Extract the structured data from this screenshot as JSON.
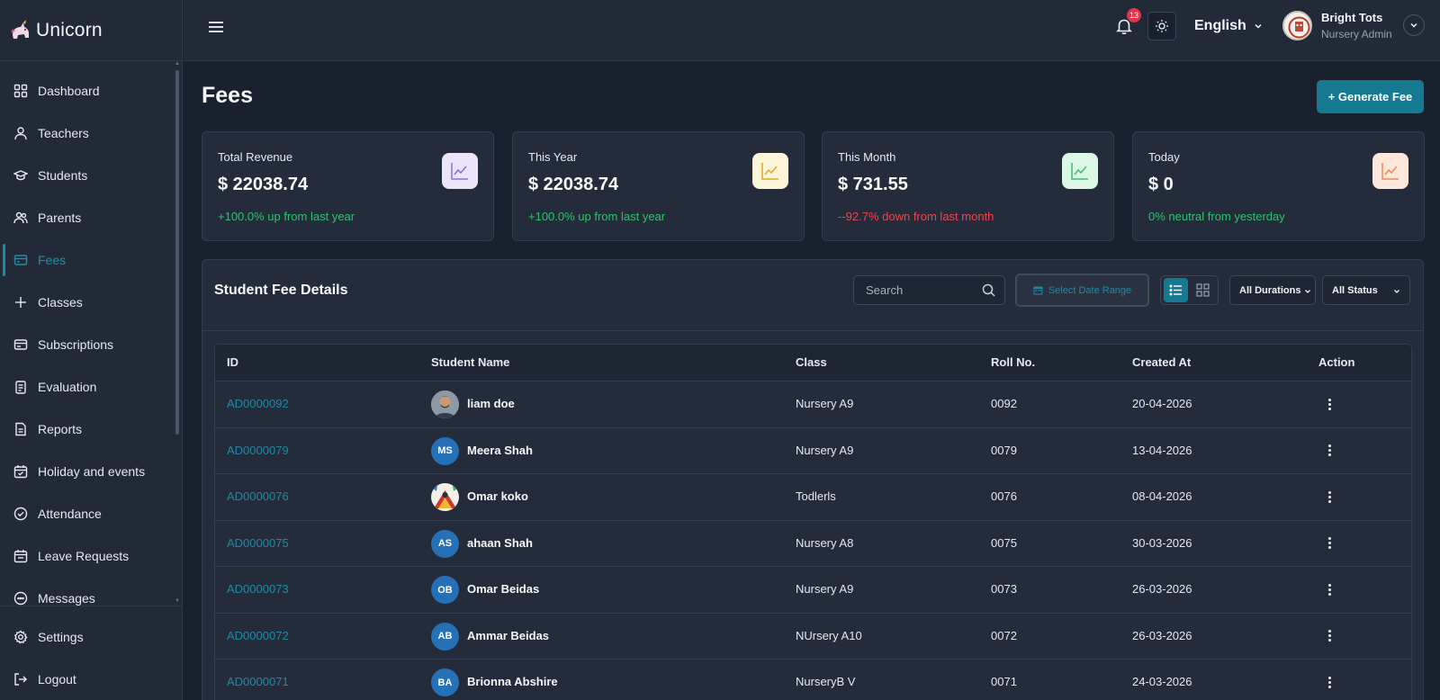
{
  "app": {
    "name": "Unicorn"
  },
  "sidebar": {
    "items": [
      {
        "label": "Dashboard",
        "icon": "dashboard-icon"
      },
      {
        "label": "Teachers",
        "icon": "user-icon"
      },
      {
        "label": "Students",
        "icon": "graduation-cap-icon"
      },
      {
        "label": "Parents",
        "icon": "users-icon"
      },
      {
        "label": "Fees",
        "icon": "credit-card-icon",
        "active": true
      },
      {
        "label": "Classes",
        "icon": "plus-icon"
      },
      {
        "label": "Subscriptions",
        "icon": "card-icon"
      },
      {
        "label": "Evaluation",
        "icon": "clipboard-icon"
      },
      {
        "label": "Reports",
        "icon": "document-icon"
      },
      {
        "label": "Holiday and events",
        "icon": "calendar-icon"
      },
      {
        "label": "Attendance",
        "icon": "check-circle-icon"
      },
      {
        "label": "Leave Requests",
        "icon": "calendar-check-icon"
      },
      {
        "label": "Messages",
        "icon": "message-icon"
      }
    ],
    "bottom": [
      {
        "label": "Settings",
        "icon": "gear-icon"
      },
      {
        "label": "Logout",
        "icon": "logout-icon"
      }
    ]
  },
  "topbar": {
    "notification_count": "13",
    "language": "English",
    "user_name": "Bright Tots",
    "user_role": "Nursery Admin"
  },
  "page": {
    "title": "Fees",
    "generate_button": "+ Generate Fee"
  },
  "stats": [
    {
      "label": "Total Revenue",
      "value": "$ 22038.74",
      "trend": "+100.0% up from last year",
      "trend_dir": "up",
      "icon_bg": "#ece4fb",
      "icon_color": "#8b6fd6"
    },
    {
      "label": "This Year",
      "value": "$ 22038.74",
      "trend": "+100.0% up from last year",
      "trend_dir": "up",
      "icon_bg": "#fdf5d9",
      "icon_color": "#e0a92c"
    },
    {
      "label": "This Month",
      "value": "$ 731.55",
      "trend": "--92.7% down from last month",
      "trend_dir": "down",
      "icon_bg": "#dcf7e6",
      "icon_color": "#3cbf6e"
    },
    {
      "label": "Today",
      "value": "$ 0",
      "trend": "0% neutral from yesterday",
      "trend_dir": "up",
      "icon_bg": "#fde6da",
      "icon_color": "#ef8a5a"
    }
  ],
  "fee_details": {
    "title": "Student Fee Details",
    "search_placeholder": "Search",
    "date_range_label": "Select Date Range",
    "durations_label": "All Durations",
    "status_label": "All Status",
    "columns": [
      "ID",
      "Student Name",
      "Class",
      "Roll No.",
      "Created At",
      "Action"
    ],
    "rows": [
      {
        "id": "AD0000092",
        "name": "liam doe",
        "initials": "",
        "avatar": "photo",
        "class": "Nursery A9",
        "roll": "0092",
        "created": "20-04-2026"
      },
      {
        "id": "AD0000079",
        "name": "Meera Shah",
        "initials": "MS",
        "avatar": "initials",
        "class": "Nursery A9",
        "roll": "0079",
        "created": "13-04-2026"
      },
      {
        "id": "AD0000076",
        "name": "Omar koko",
        "initials": "",
        "avatar": "photo2",
        "class": "Todlerls",
        "roll": "0076",
        "created": "08-04-2026"
      },
      {
        "id": "AD0000075",
        "name": "ahaan Shah",
        "initials": "AS",
        "avatar": "initials",
        "class": "Nursery A8",
        "roll": "0075",
        "created": "30-03-2026"
      },
      {
        "id": "AD0000073",
        "name": "Omar Beidas",
        "initials": "OB",
        "avatar": "initials",
        "class": "Nursery A9",
        "roll": "0073",
        "created": "26-03-2026"
      },
      {
        "id": "AD0000072",
        "name": "Ammar Beidas",
        "initials": "AB",
        "avatar": "initials",
        "class": "NUrsery A10",
        "roll": "0072",
        "created": "26-03-2026"
      },
      {
        "id": "AD0000071",
        "name": "Brionna Abshire",
        "initials": "BA",
        "avatar": "initials",
        "class": "NurseryB V",
        "roll": "0071",
        "created": "24-03-2026"
      }
    ]
  },
  "colors": {
    "accent": "#157a91",
    "link": "#1f8aa3",
    "up": "#2fc26d",
    "down": "#f0444e"
  }
}
